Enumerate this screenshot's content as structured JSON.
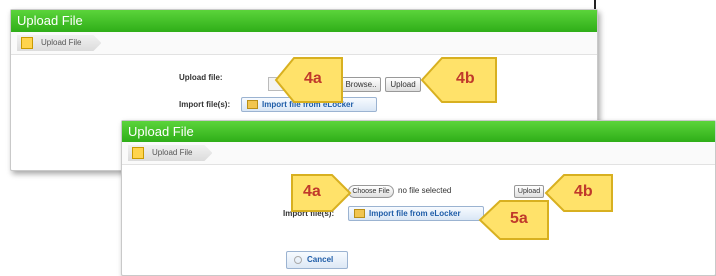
{
  "dialog_back": {
    "title": "Upload File",
    "breadcrumb": "Upload File",
    "upload_label": "Upload file:",
    "browse_label": "Browse..",
    "upload_button": "Upload",
    "import_label": "Import file(s):",
    "import_button": "Import file from eLocker"
  },
  "dialog_front": {
    "title": "Upload File",
    "breadcrumb": "Upload File",
    "choose_file_button": "Choose File",
    "no_file_text": "no file selected",
    "upload_button": "Upload",
    "import_label": "Import file(s):",
    "import_button": "Import file from eLocker",
    "cancel_button": "Cancel"
  },
  "callouts": {
    "back_4a": "4a",
    "back_4b": "4b",
    "front_4a": "4a",
    "front_4b": "4b",
    "front_5a": "5a"
  },
  "colors": {
    "titlebar_green": "#3cbf24",
    "callout_fill": "#ffe26a",
    "callout_text": "#c0392b",
    "link_blue": "#1f5da8"
  }
}
